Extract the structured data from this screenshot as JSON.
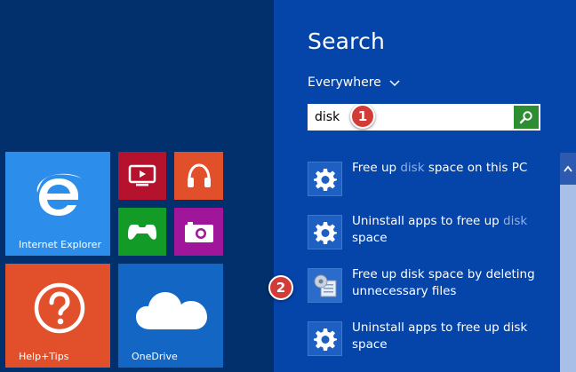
{
  "start_screen": {
    "tiles": {
      "internet_explorer": {
        "label": "Internet Explorer",
        "color": "#2c8dea"
      },
      "video": {
        "color": "#b5122e"
      },
      "music": {
        "color": "#e1502a"
      },
      "games": {
        "color": "#129b26"
      },
      "camera": {
        "color": "#a0169b"
      },
      "help_tips": {
        "label": "Help+Tips",
        "color": "#e1502a"
      },
      "onedrive": {
        "label": "OneDrive",
        "color": "#1466c4"
      }
    }
  },
  "search_pane": {
    "title": "Search",
    "scope": "Everywhere",
    "query": "disk",
    "accent": "#2d8d31",
    "results": [
      {
        "pre": "Free up ",
        "hl": "disk",
        "post": " space on this PC",
        "icon": "gear-icon"
      },
      {
        "pre": "Uninstall apps to free up ",
        "hl": "disk",
        "post": " space",
        "icon": "gear-icon"
      },
      {
        "pre": "Free up disk space by deleting unnecessary files",
        "hl": "",
        "post": "",
        "icon": "disk-cleanup-icon"
      },
      {
        "pre": "Uninstall apps to free up disk space",
        "hl": "",
        "post": "",
        "icon": "gear-icon"
      }
    ]
  },
  "annotations": {
    "step1": "1",
    "step2": "2"
  }
}
